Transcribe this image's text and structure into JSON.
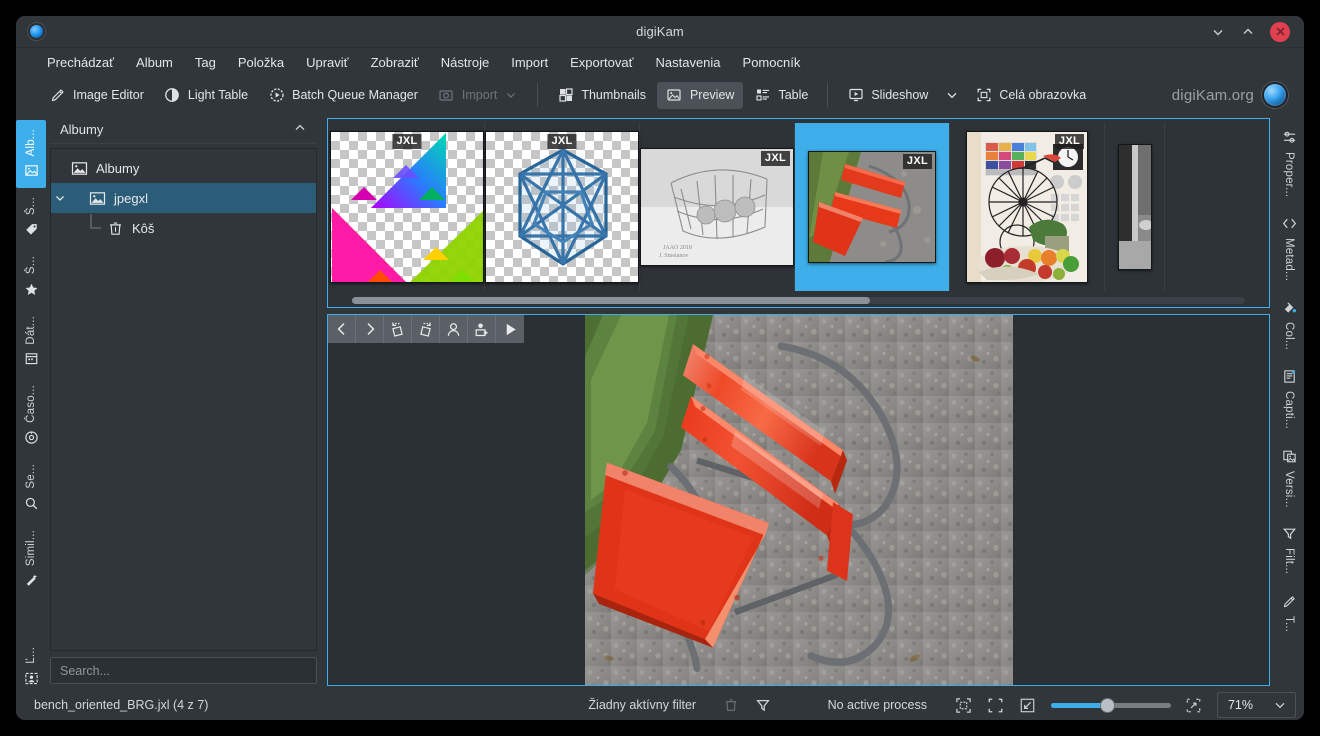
{
  "window": {
    "title": "digiKam",
    "app_icon": "digikam-globe-icon",
    "minimize_label": "chevron-down-icon",
    "maximize_label": "chevron-up-icon",
    "close_label": "close-icon"
  },
  "menubar": {
    "items": [
      {
        "label": "Prechádzať"
      },
      {
        "label": "Album"
      },
      {
        "label": "Tag"
      },
      {
        "label": "Položka"
      },
      {
        "label": "Upraviť"
      },
      {
        "label": "Zobraziť"
      },
      {
        "label": "Nástroje"
      },
      {
        "label": "Import"
      },
      {
        "label": "Exportovať"
      },
      {
        "label": "Nastavenia"
      },
      {
        "label": "Pomocník"
      }
    ]
  },
  "toolbar": {
    "image_editor": "Image Editor",
    "light_table": "Light Table",
    "batch_queue_manager": "Batch Queue Manager",
    "import": "Import",
    "thumbnails": "Thumbnails",
    "preview": "Preview",
    "table": "Table",
    "slideshow": "Slideshow",
    "fullscreen": "Celá obrazovka",
    "brand": "digiKam.org"
  },
  "left_rail": {
    "items": [
      {
        "label": "Alb...",
        "icon": "albums-icon",
        "selected": true
      },
      {
        "label": "Š...",
        "icon": "tag-icon",
        "selected": false
      },
      {
        "label": "Š...",
        "icon": "star-rating-icon",
        "selected": false
      },
      {
        "label": "Dát...",
        "icon": "calendar-icon",
        "selected": false
      },
      {
        "label": "Časo...",
        "icon": "timeline-icon",
        "selected": false
      },
      {
        "label": "Se...",
        "icon": "search-icon",
        "selected": false
      },
      {
        "label": "Simil...",
        "icon": "similarity-wand-icon",
        "selected": false
      },
      {
        "label": "Ľ...",
        "icon": "people-icon",
        "selected": false
      }
    ]
  },
  "right_rail": {
    "items": [
      {
        "label": "Proper...",
        "icon": "properties-icon"
      },
      {
        "label": "Metad...",
        "icon": "metadata-icon"
      },
      {
        "label": "Col...",
        "icon": "colors-icon"
      },
      {
        "label": "Capti...",
        "icon": "caption-icon"
      },
      {
        "label": "Versi...",
        "icon": "versions-icon"
      },
      {
        "label": "Filt...",
        "icon": "filters-icon"
      },
      {
        "label": "T...",
        "icon": "tools-pencil-icon"
      }
    ]
  },
  "albums_panel": {
    "header": "Albumy",
    "collapse_icon": "chevron-up-icon",
    "tree": [
      {
        "label": "Albumy",
        "icon": "album-root-icon",
        "depth": 0,
        "selected": false,
        "twisty": "none"
      },
      {
        "label": "jpegxl",
        "icon": "album-icon",
        "depth": 1,
        "selected": true,
        "twisty": "expanded"
      },
      {
        "label": "Kôš",
        "icon": "trash-icon",
        "depth": 2,
        "selected": false,
        "twisty": "none"
      }
    ],
    "search_placeholder": "Search...",
    "search_value": ""
  },
  "filmstrip": {
    "format_badge": "JXL",
    "thumbnails": [
      {
        "name": "fractal-gradient-transparent",
        "selected": false
      },
      {
        "name": "icosahedron-wireframe-transparent",
        "selected": false
      },
      {
        "name": "glass-wire-basket-grayscale",
        "selected": false
      },
      {
        "name": "red-bench-on-gravel",
        "selected": true
      },
      {
        "name": "penny-farthing-fruit-colorchart",
        "selected": false
      },
      {
        "name": "street-scene-grayscale",
        "selected": false
      }
    ],
    "scroll_position_percent": 0
  },
  "preview": {
    "toolbar_buttons": [
      {
        "name": "previous-image-button",
        "icon": "chevron-left-icon"
      },
      {
        "name": "next-image-button",
        "icon": "chevron-right-icon"
      },
      {
        "name": "rotate-left-button",
        "icon": "rotate-left-icon"
      },
      {
        "name": "rotate-right-button",
        "icon": "rotate-right-icon"
      },
      {
        "name": "face-detect-button",
        "icon": "person-icon"
      },
      {
        "name": "add-face-button",
        "icon": "person-add-icon"
      },
      {
        "name": "slideshow-play-button",
        "icon": "play-icon"
      }
    ],
    "image_name": "red-bench-on-gravel"
  },
  "statusbar": {
    "file_info": "bench_oriented_BRG.jxl (4 z 7)",
    "filter_text": "Žiadny aktívny filter",
    "process_text": "No active process",
    "trash_icon": "trash-icon",
    "filter_icon": "funnel-icon",
    "fit_window_icon": "fit-to-window-icon",
    "fit_original_icon": "zoom-100-icon",
    "fit_width_icon": "fit-to-width-icon",
    "fullscreen_icon": "expand-icon",
    "zoom_value": "71%",
    "zoom_dropdown_icon": "chevron-down-icon"
  },
  "colors": {
    "accent": "#3daee9",
    "window_bg": "#31363b",
    "selection": "#2c5d78",
    "close": "#e04050"
  }
}
